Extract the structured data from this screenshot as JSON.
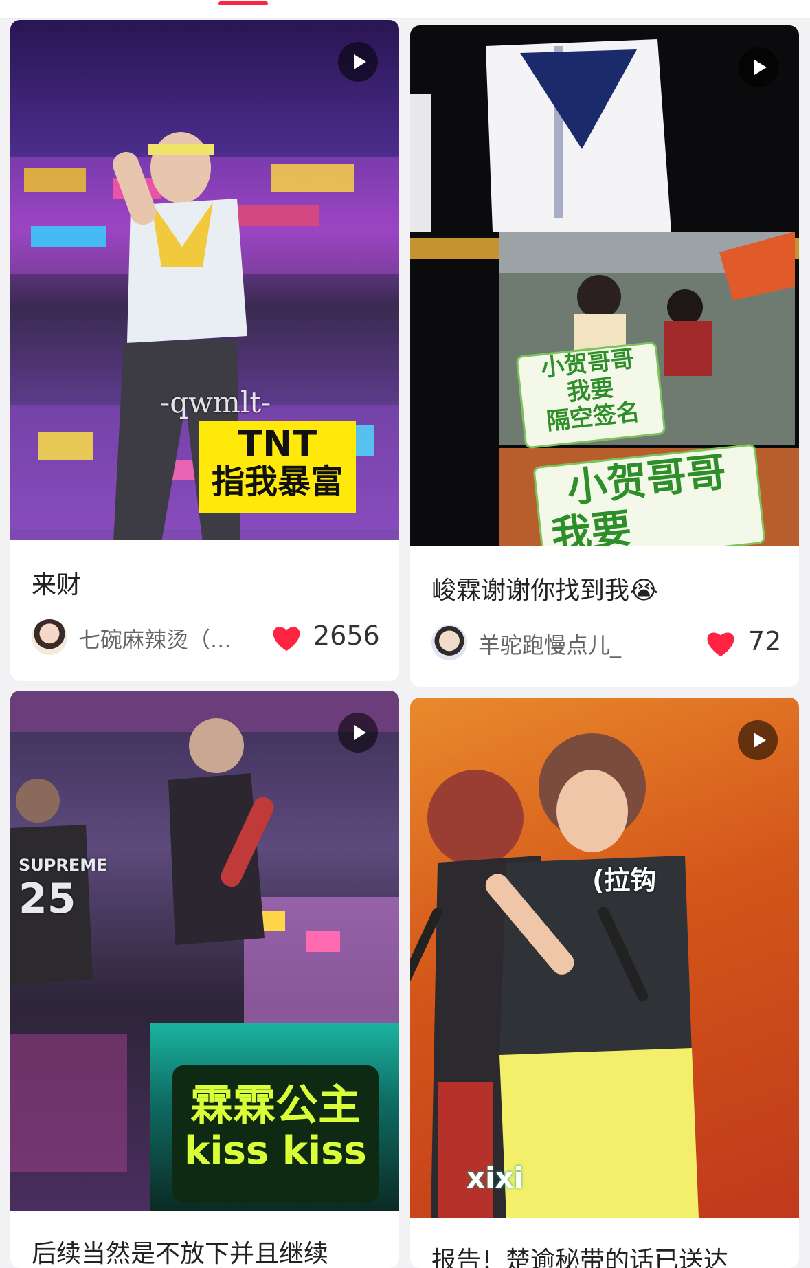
{
  "feed": {
    "cards": [
      {
        "title": "来财",
        "author": "七碗麻辣烫（...",
        "likes": "2656",
        "overlay": {
          "watermark": "-qwmlt-",
          "line1": "TNT",
          "line2": "指我暴富"
        }
      },
      {
        "title": "峻霖谢谢你找到我😭",
        "author": "羊驼跑慢点儿_",
        "likes": "72",
        "overlay": {
          "sign_line1": "小贺哥哥",
          "sign_line2": "我要",
          "sign_line3": "隔空签名"
        }
      },
      {
        "title": "后续当然是不放下并且继续",
        "overlay": {
          "jersey1": "SUPREME",
          "jersey2": "25",
          "line1": "霖霖公主",
          "line2": "kiss kiss"
        }
      },
      {
        "title": "报告！楚逾秘带的话已送达",
        "overlay": {
          "caption": "(拉钩",
          "caption2": "xixi"
        }
      }
    ]
  },
  "colors": {
    "accent": "#ff2442",
    "heart": "#ff2442"
  },
  "icons": {
    "play": "play-icon",
    "like": "heart-icon"
  }
}
